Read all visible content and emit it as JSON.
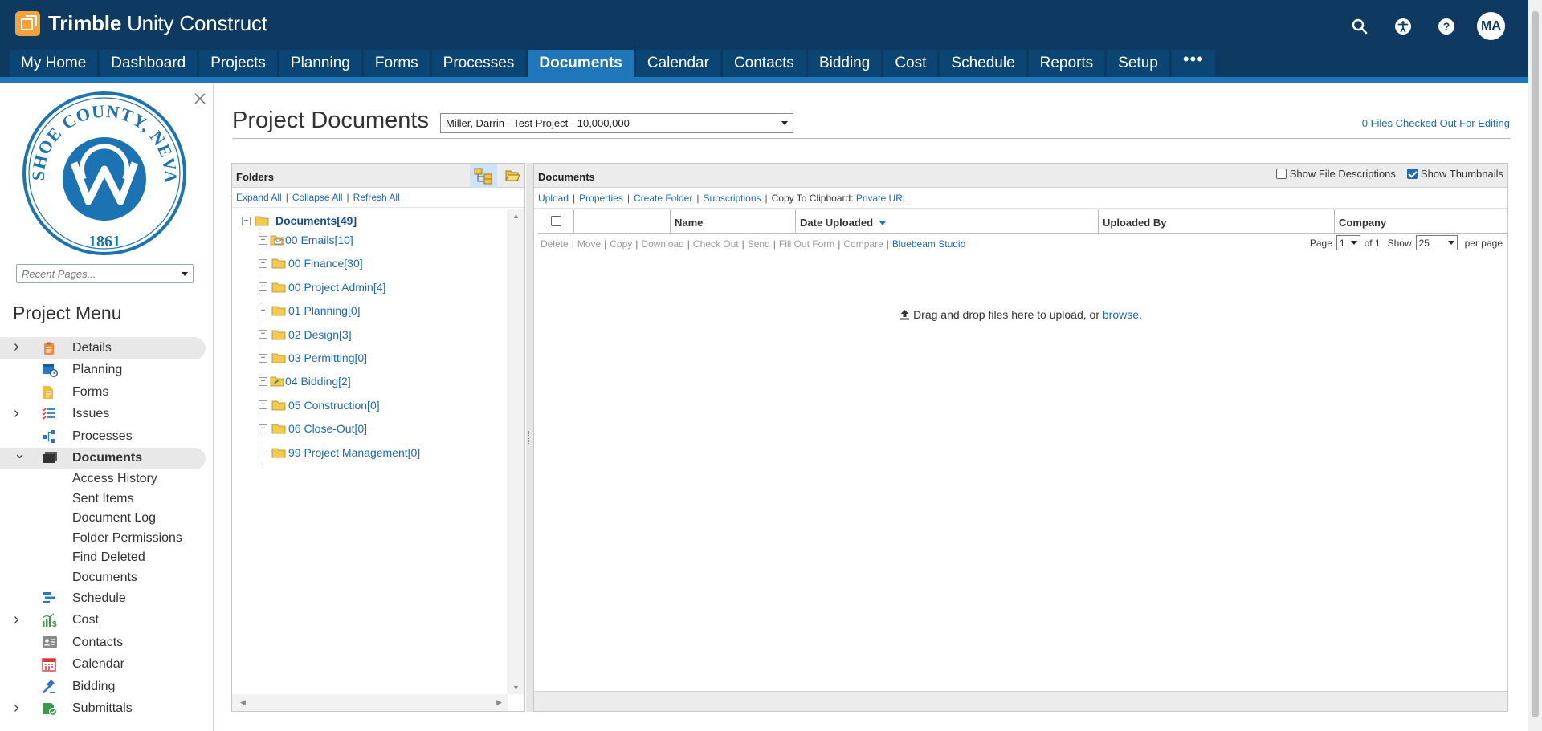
{
  "app": {
    "brand_bold": "Trimble",
    "brand_rest": " Unity Construct",
    "avatar_initials": "MA"
  },
  "nav": {
    "tabs": [
      {
        "label": "My Home",
        "active": false
      },
      {
        "label": "Dashboard",
        "active": false
      },
      {
        "label": "Projects",
        "active": false
      },
      {
        "label": "Planning",
        "active": false
      },
      {
        "label": "Forms",
        "active": false
      },
      {
        "label": "Processes",
        "active": false
      },
      {
        "label": "Documents",
        "active": true
      },
      {
        "label": "Calendar",
        "active": false
      },
      {
        "label": "Contacts",
        "active": false
      },
      {
        "label": "Bidding",
        "active": false
      },
      {
        "label": "Cost",
        "active": false
      },
      {
        "label": "Schedule",
        "active": false
      },
      {
        "label": "Reports",
        "active": false
      },
      {
        "label": "Setup",
        "active": false
      }
    ],
    "more_label": "•••"
  },
  "sidebar": {
    "seal": {
      "top_text": "WASHOE COUNTY, NEVADA",
      "year": "1861"
    },
    "recent_placeholder": "Recent Pages...",
    "menu_title": "Project Menu",
    "items": [
      {
        "label": "Details",
        "icon": "clipboard-icon",
        "chevron": "›",
        "highlight": true
      },
      {
        "label": "Planning",
        "icon": "calendar-clock-icon",
        "chevron": "",
        "highlight": false
      },
      {
        "label": "Forms",
        "icon": "form-icon",
        "chevron": "",
        "highlight": false
      },
      {
        "label": "Issues",
        "icon": "checklist-icon",
        "chevron": "›",
        "highlight": false
      },
      {
        "label": "Processes",
        "icon": "workflow-icon",
        "chevron": "",
        "highlight": false
      },
      {
        "label": "Documents",
        "icon": "documents-icon",
        "chevron": "⌄",
        "highlight": true,
        "bold": true
      }
    ],
    "sub_items": [
      "Access History",
      "Sent Items",
      "Document Log",
      "Folder Permissions",
      "Find Deleted",
      "Documents"
    ],
    "items_after": [
      {
        "label": "Schedule",
        "icon": "schedule-icon",
        "chevron": ""
      },
      {
        "label": "Cost",
        "icon": "cost-chart-icon",
        "chevron": "›"
      },
      {
        "label": "Contacts",
        "icon": "contact-card-icon",
        "chevron": ""
      },
      {
        "label": "Calendar",
        "icon": "calendar-icon",
        "chevron": ""
      },
      {
        "label": "Bidding",
        "icon": "gavel-icon",
        "chevron": ""
      },
      {
        "label": "Submittals",
        "icon": "submittals-icon",
        "chevron": "›"
      }
    ]
  },
  "main": {
    "page_title": "Project Documents",
    "project_select": "Miller, Darrin - Test Project - 10,000,000",
    "checked_out": "0 Files Checked Out For Editing"
  },
  "folders": {
    "title": "Folders",
    "links": [
      "Expand All",
      "Collapse All",
      "Refresh All"
    ],
    "root": "Documents[49]",
    "nodes": [
      {
        "label": "00 Emails[10]",
        "icon": "email-folder-icon",
        "expander": true
      },
      {
        "label": "00 Finance[30]",
        "icon": "folder-icon",
        "expander": true
      },
      {
        "label": "00 Project Admin[4]",
        "icon": "folder-icon",
        "expander": true
      },
      {
        "label": "01 Planning[0]",
        "icon": "folder-icon",
        "expander": true
      },
      {
        "label": "02 Design[3]",
        "icon": "folder-icon",
        "expander": true
      },
      {
        "label": "03 Permitting[0]",
        "icon": "folder-icon",
        "expander": true
      },
      {
        "label": "04 Bidding[2]",
        "icon": "bid-folder-icon",
        "expander": true
      },
      {
        "label": "05 Construction[0]",
        "icon": "folder-icon",
        "expander": true
      },
      {
        "label": "06 Close-Out[0]",
        "icon": "folder-icon",
        "expander": true
      },
      {
        "label": "99 Project Management[0]",
        "icon": "folder-icon",
        "expander": false
      }
    ]
  },
  "documents": {
    "title": "Documents",
    "show_descriptions": "Show File Descriptions",
    "show_thumbnails": "Show Thumbnails",
    "toolbar_links": [
      "Upload",
      "Properties",
      "Create Folder",
      "Subscriptions"
    ],
    "clipboard_label": "Copy To Clipboard:",
    "clipboard_link": "Private URL",
    "columns": [
      "",
      "",
      "Name",
      "Date Uploaded",
      "Uploaded By",
      "Company"
    ],
    "actions_disabled": [
      "Delete",
      "Move",
      "Copy",
      "Download",
      "Check Out",
      "Send",
      "Fill Out Form",
      "Compare"
    ],
    "action_enabled": "Bluebeam Studio",
    "pager": {
      "page_label": "Page",
      "page": "1",
      "of_label": "of 1",
      "show_label": "Show",
      "show": "25",
      "per_page": "per page"
    },
    "drop_text": "Drag and drop files here to upload, or",
    "browse": "browse",
    "drop_suffix": "."
  }
}
